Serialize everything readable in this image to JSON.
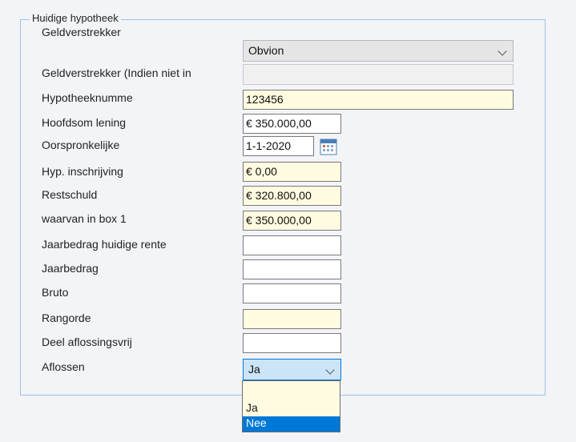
{
  "group": {
    "title": "Huidige hypotheek"
  },
  "labels": {
    "geldverstrekker": "Geldverstrekker",
    "geldverstrekker_indien": "Geldverstrekker (Indien niet in",
    "hypotheeknummer": "Hypotheeknumme",
    "hoofdsom": "Hoofdsom lening",
    "oorspronkelijke": "Oorspronkelijke",
    "inschrijving": "Hyp. inschrijving",
    "restschuld": "Restschuld",
    "box1": "waarvan in box 1",
    "jaarbedrag_rente": "Jaarbedrag huidige rente",
    "jaarbedrag": "Jaarbedrag",
    "bruto": "Bruto",
    "rangorde": "Rangorde",
    "deel_aflossingsvrij": "Deel aflossingsvrij",
    "aflossen": "Aflossen"
  },
  "values": {
    "geldverstrekker": "Obvion",
    "geldverstrekker_indien": "",
    "hypotheeknummer": "123456",
    "hoofdsom": "€ 350.000,00",
    "oorspronkelijke": "1-1-2020",
    "inschrijving": "€ 0,00",
    "restschuld": "€ 320.800,00",
    "box1": "€ 350.000,00",
    "jaarbedrag_rente": "",
    "jaarbedrag": "",
    "bruto": "",
    "rangorde": "",
    "deel_aflossingsvrij": "",
    "aflossen": "Ja"
  },
  "dropdown": {
    "options": [
      "Ja",
      "Nee"
    ],
    "highlighted": "Nee",
    "highlight_color": "#0078d7"
  },
  "icons": {
    "calendar": "calendar-icon",
    "chevron": "chevron-down-icon"
  }
}
